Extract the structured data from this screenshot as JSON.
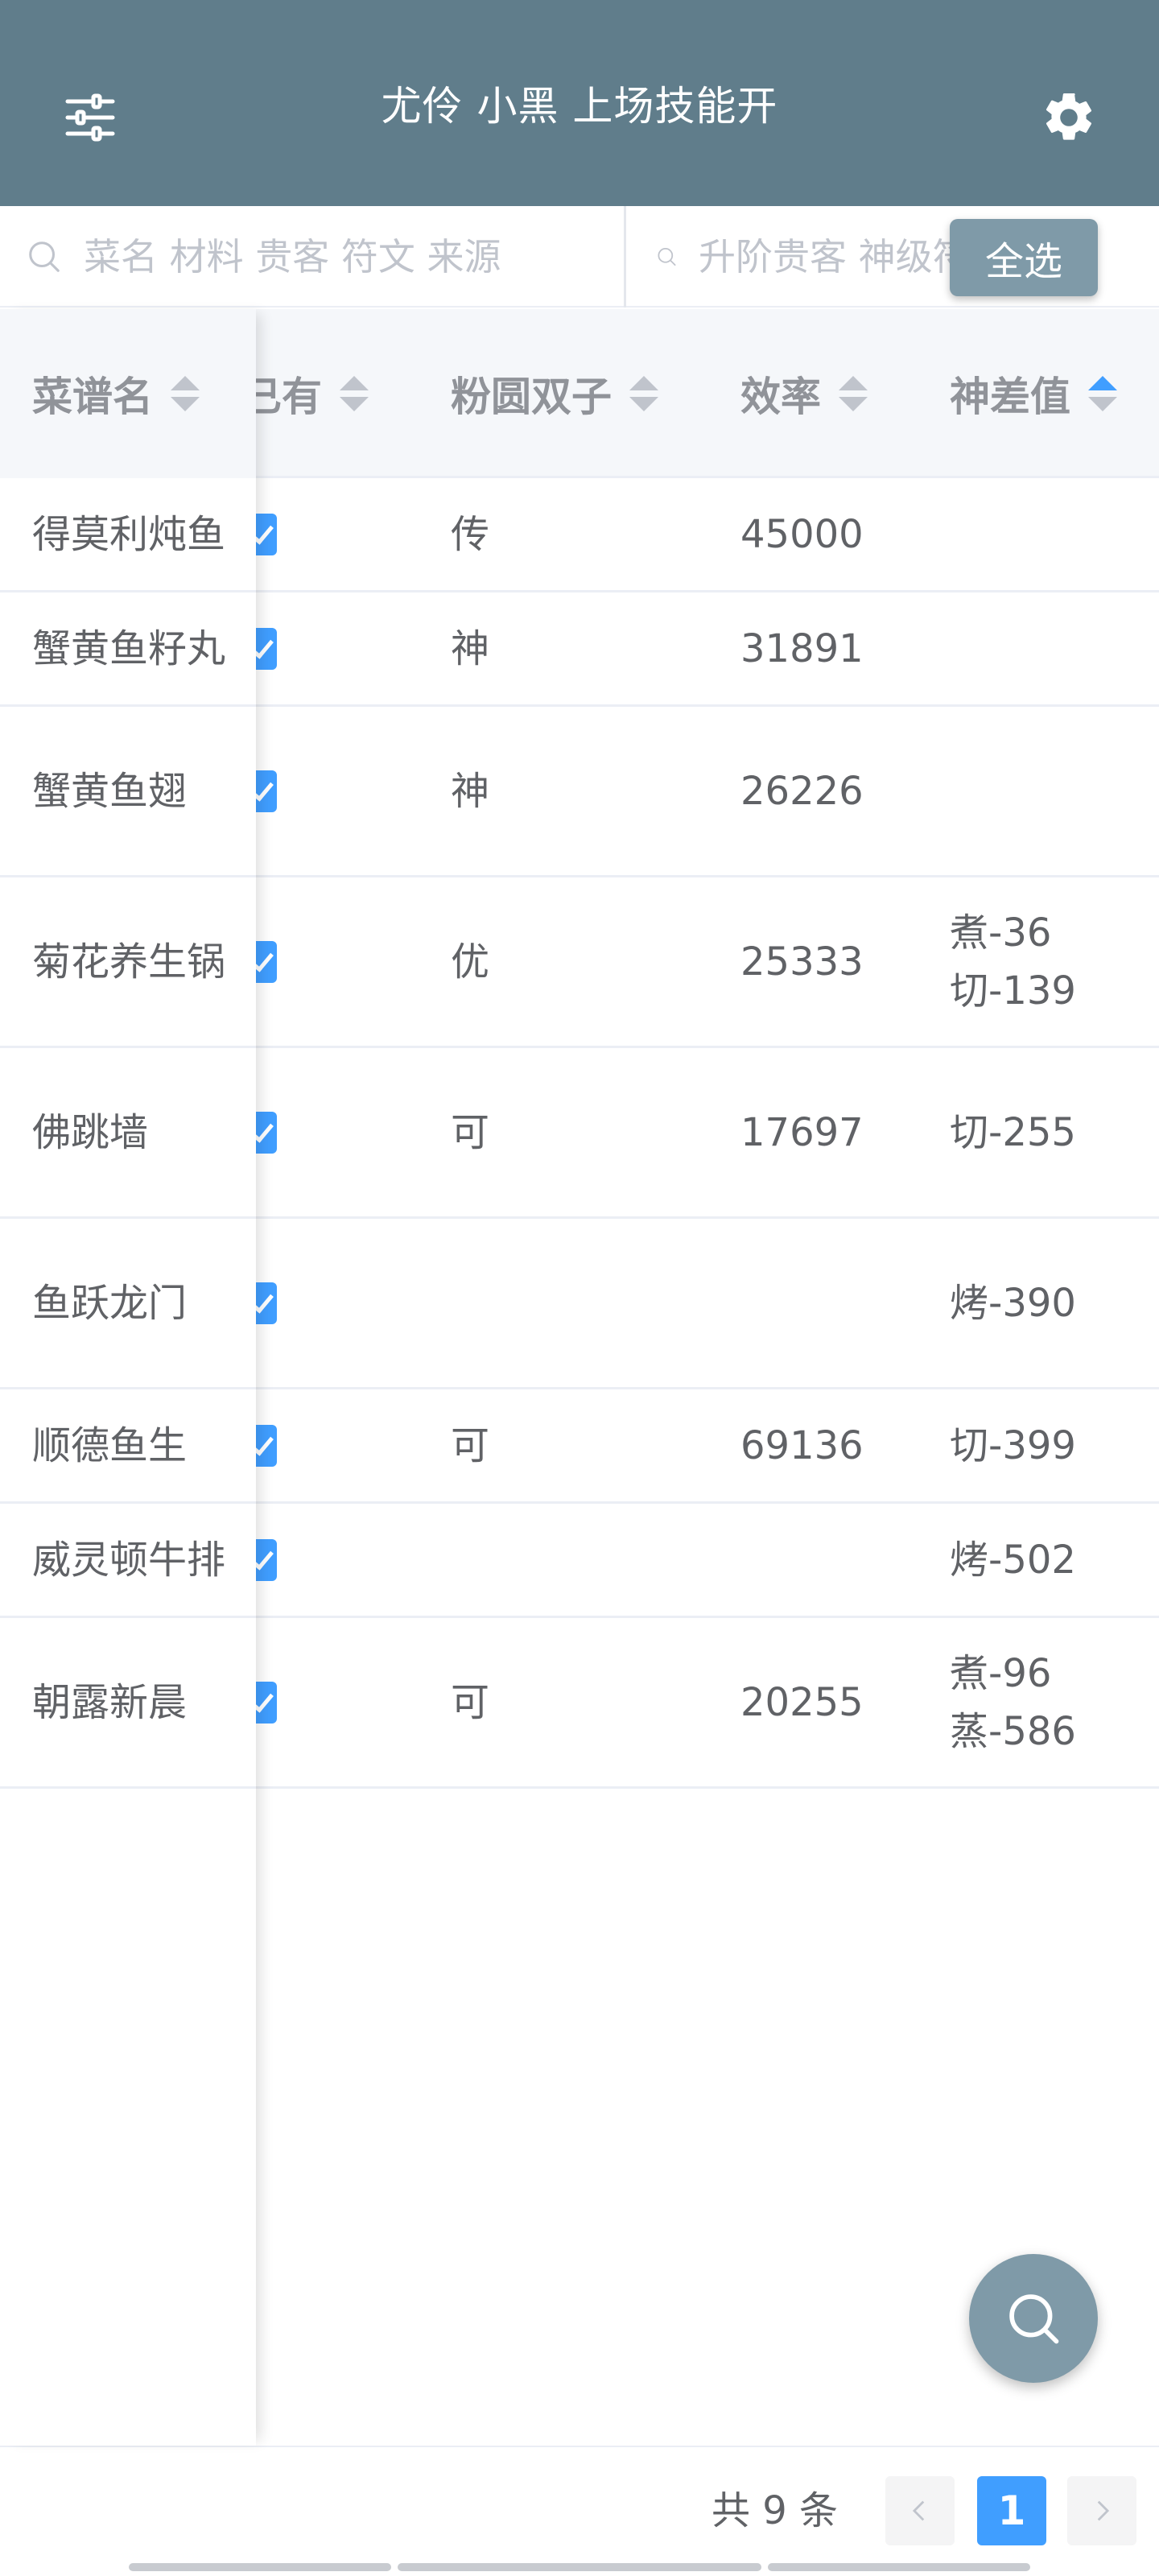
{
  "header": {
    "title": "尤伶 小黑 上场技能开",
    "menu_icon": "sliders-icon",
    "settings_icon": "gear-icon"
  },
  "search": {
    "left_placeholder": "菜名 材料 贵客 符文 来源",
    "right_placeholder": "升阶贵客 神级符文",
    "select_all_label": "全选"
  },
  "table": {
    "columns": [
      {
        "label": "菜谱名",
        "sort": "none"
      },
      {
        "label": "已有",
        "sort": "none"
      },
      {
        "label": "粉圆双子",
        "sort": "none"
      },
      {
        "label": "效率",
        "sort": "none"
      },
      {
        "label": "神差值",
        "sort": "ascending"
      }
    ],
    "rows": [
      {
        "name": "得莫利炖鱼",
        "owned": true,
        "guest": "传",
        "efficiency": "45000",
        "diff": [
          "",
          ""
        ]
      },
      {
        "name": "蟹黄鱼籽丸",
        "owned": true,
        "guest": "神",
        "efficiency": "31891",
        "diff": [
          "",
          ""
        ]
      },
      {
        "name": "蟹黄鱼翅",
        "owned": true,
        "guest": "神",
        "efficiency": "26226",
        "diff": [
          "",
          ""
        ]
      },
      {
        "name": "菊花养生锅",
        "owned": true,
        "guest": "优",
        "efficiency": "25333",
        "diff": [
          "煮-36",
          "切-139"
        ]
      },
      {
        "name": "佛跳墙",
        "owned": true,
        "guest": "可",
        "efficiency": "17697",
        "diff": [
          "切-255",
          ""
        ]
      },
      {
        "name": "鱼跃龙门",
        "owned": true,
        "guest": "",
        "efficiency": "",
        "diff": [
          "烤-390",
          ""
        ]
      },
      {
        "name": "顺德鱼生",
        "owned": true,
        "guest": "可",
        "efficiency": "69136",
        "diff": [
          "切-399",
          ""
        ]
      },
      {
        "name": "威灵顿牛排",
        "owned": true,
        "guest": "",
        "efficiency": "",
        "diff": [
          "烤-502",
          ""
        ]
      },
      {
        "name": "朝露新晨",
        "owned": true,
        "guest": "可",
        "efficiency": "20255",
        "diff": [
          "煮-96",
          "蒸-586"
        ]
      }
    ]
  },
  "pagination": {
    "total_text": "共 9 条",
    "current_page": "1",
    "prev_icon": "chevron-left-icon",
    "next_icon": "chevron-right-icon"
  },
  "fab": {
    "icon": "search-icon"
  },
  "colors": {
    "header_bg": "#607d8b",
    "accent": "#409eff",
    "button_bg": "#7f9aa8"
  }
}
